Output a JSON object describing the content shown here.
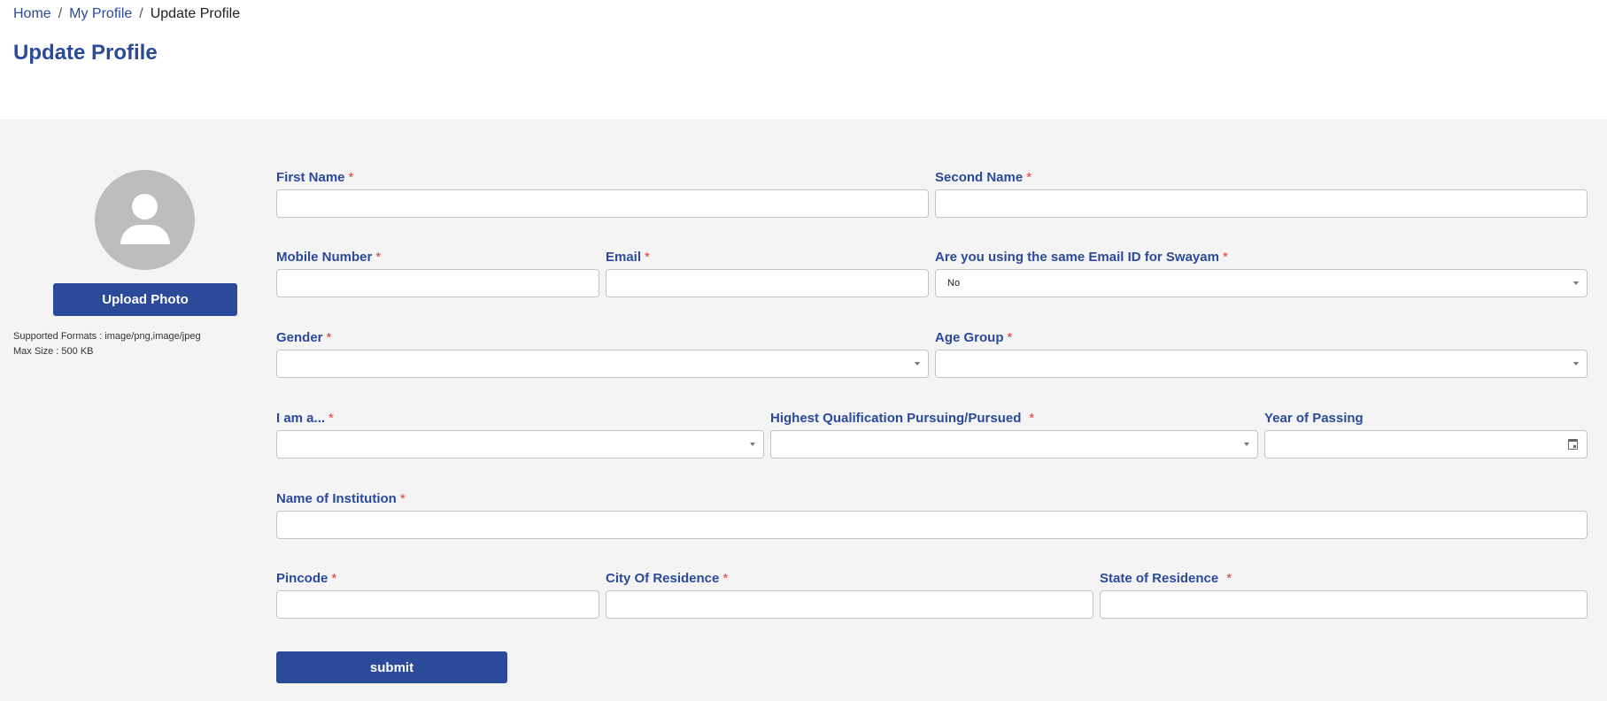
{
  "breadcrumb": {
    "items": [
      {
        "label": "Home"
      },
      {
        "label": "My Profile"
      },
      {
        "label": "Update Profile"
      }
    ],
    "separator": "/"
  },
  "page": {
    "title": "Update Profile"
  },
  "photo": {
    "upload_label": "Upload Photo",
    "supported_formats": "Supported Formats : image/png,image/jpeg",
    "max_size": "Max Size : 500 KB"
  },
  "form": {
    "required_marker": "*",
    "fields": {
      "first_name": {
        "label": "First Name",
        "value": "",
        "required": true
      },
      "second_name": {
        "label": "Second Name",
        "value": "",
        "required": true
      },
      "mobile": {
        "label": "Mobile Number",
        "value": "",
        "required": true
      },
      "email": {
        "label": "Email",
        "value": "",
        "required": true
      },
      "same_email": {
        "label": "Are you using the same Email ID for Swayam",
        "value": "No",
        "required": true
      },
      "gender": {
        "label": "Gender",
        "value": "",
        "required": true
      },
      "age_group": {
        "label": "Age Group",
        "value": "",
        "required": true
      },
      "i_am_a": {
        "label": "I am a...",
        "value": "",
        "required": true
      },
      "qualification": {
        "label": "Highest Qualification Pursuing/Pursued",
        "value": "",
        "required": true
      },
      "year_of_passing": {
        "label": "Year of Passing",
        "value": "",
        "required": false
      },
      "institution": {
        "label": "Name of Institution",
        "value": "",
        "required": true
      },
      "pincode": {
        "label": "Pincode",
        "value": "",
        "required": true
      },
      "city": {
        "label": "City Of Residence",
        "value": "",
        "required": true
      },
      "state": {
        "label": "State of Residence",
        "value": "",
        "required": true
      }
    },
    "submit_label": "submit"
  },
  "colors": {
    "primary": "#2b4a9a",
    "required": "#e53935",
    "background": "#f4f4f4"
  }
}
